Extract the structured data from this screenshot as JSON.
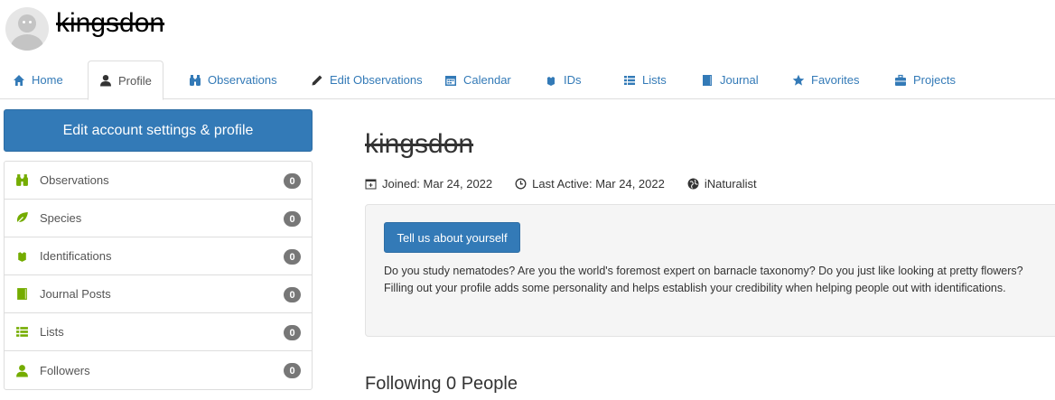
{
  "header": {
    "username": "kingsdon"
  },
  "tabs": [
    {
      "label": "Home",
      "icon": "home-icon"
    },
    {
      "label": "Profile",
      "icon": "user-icon"
    },
    {
      "label": "Observations",
      "icon": "binoculars-icon"
    },
    {
      "label": "Edit Observations",
      "icon": "pencil-icon"
    },
    {
      "label": "Calendar",
      "icon": "calendar-icon"
    },
    {
      "label": "IDs",
      "icon": "identification-tag-icon"
    },
    {
      "label": "Lists",
      "icon": "list-icon"
    },
    {
      "label": "Journal",
      "icon": "book-icon"
    },
    {
      "label": "Favorites",
      "icon": "star-icon"
    },
    {
      "label": "Projects",
      "icon": "briefcase-icon"
    }
  ],
  "sidebar": {
    "edit_button": "Edit account settings & profile",
    "stats": [
      {
        "label": "Observations",
        "count": "0",
        "icon": "binoculars-icon"
      },
      {
        "label": "Species",
        "count": "0",
        "icon": "leaf-icon"
      },
      {
        "label": "Identifications",
        "count": "0",
        "icon": "identification-tag-icon"
      },
      {
        "label": "Journal Posts",
        "count": "0",
        "icon": "book-icon"
      },
      {
        "label": "Lists",
        "count": "0",
        "icon": "list-icon"
      },
      {
        "label": "Followers",
        "count": "0",
        "icon": "user-icon"
      }
    ]
  },
  "main": {
    "username": "kingsdon",
    "joined": "Joined: Mar 24, 2022",
    "last_active": "Last Active: Mar 24, 2022",
    "site": "iNaturalist",
    "tell_button": "Tell us about yourself",
    "about_text": "Do you study nematodes? Are you the world's foremost expert on barnacle taxonomy? Do you just like looking at pretty flowers? Filling out your profile adds some personality and helps establish your credibility when helping people out with identifications.",
    "following": "Following 0 People"
  },
  "colors": {
    "link": "#337ab7",
    "primary_button": "#337ab7",
    "badge": "#777777",
    "nature_green": "#74ac00"
  }
}
